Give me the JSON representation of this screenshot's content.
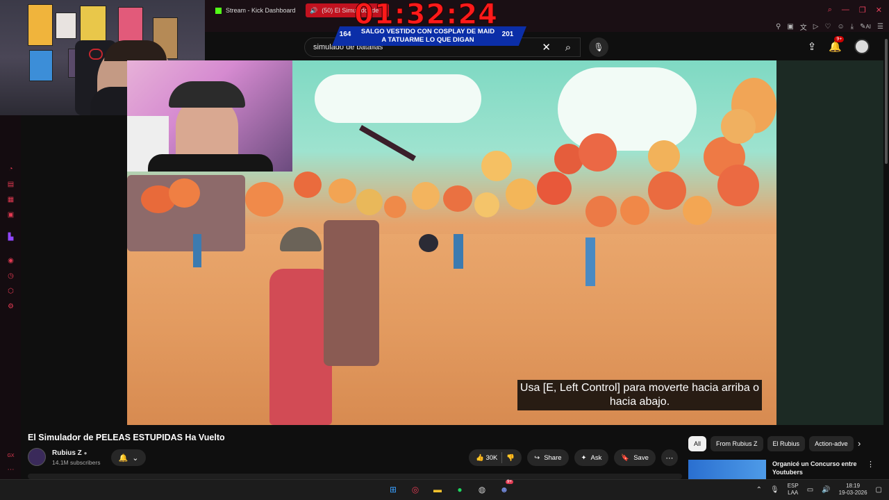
{
  "browser": {
    "tabs": [
      {
        "label": "Stream - Kick Dashboard",
        "active": false
      },
      {
        "label": "(50) El Simulador de",
        "active": true
      }
    ],
    "window_controls": [
      "search",
      "minimize",
      "restore",
      "close"
    ],
    "toolbar_ai_label": "AI"
  },
  "youtube": {
    "search": {
      "value": "simulado de batallas"
    },
    "notifications_badge": "9+",
    "video": {
      "caption": "Usa [E, Left Control] para moverte hacia arriba o hacia abajo.",
      "title": "El Simulador de PELEAS ESTUPIDAS Ha Vuelto"
    },
    "channel": {
      "name": "Rubius Z",
      "subscribers": "14.1M subscribers"
    },
    "actions": {
      "likes": "30K",
      "share": "Share",
      "ask": "Ask",
      "save": "Save"
    },
    "chips": [
      "All",
      "From Rubius Z",
      "El Rubius",
      "Action-adve"
    ],
    "recommendation": {
      "title": "Organicé un Concurso entre Youtubers"
    }
  },
  "overlay": {
    "timer": "01:32:24",
    "banner_left": "164",
    "banner_text": "SALGO VESTIDO CON COSPLAY DE MAID A TATUARME LO QUE DIGAN",
    "banner_right": "201"
  },
  "taskbar": {
    "lang_line1": "ESP",
    "lang_line2": "LAA",
    "time": "18:19",
    "date": "19-03-2026",
    "chat_badge": "9+"
  },
  "colors": {
    "accent": "#e23a52",
    "yt_red": "#cc0000",
    "kick_green": "#53fc18",
    "timer_red": "#ff1a1a",
    "banner_blue": "#0b2ea8"
  }
}
